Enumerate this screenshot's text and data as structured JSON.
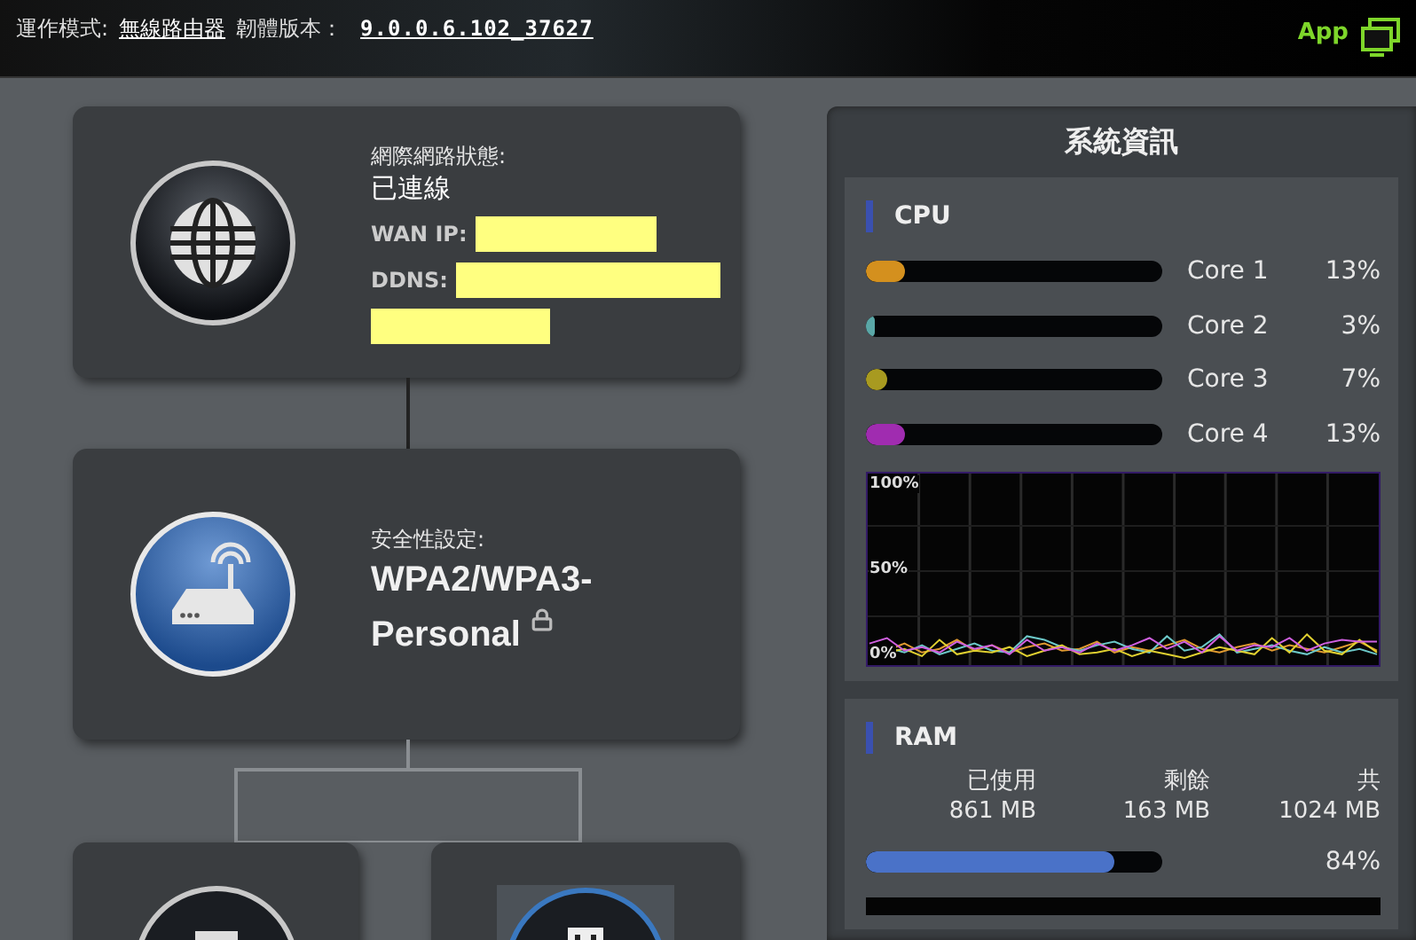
{
  "top_bar": {
    "mode_label": "運作模式:",
    "mode_value": "無線路由器",
    "firmware_label": "韌體版本：",
    "firmware_value": "9.0.0.6.102_37627",
    "app_label": "App"
  },
  "internet_card": {
    "status_label": "網際網路狀態:",
    "status_value": "已連線",
    "wan_ip_label": "WAN IP:",
    "ddns_label": "DDNS:"
  },
  "wireless_card": {
    "security_label": "安全性設定:",
    "security_value": "WPA2/WPA3-Personal",
    "locked": true
  },
  "system_info": {
    "title": "系統資訊",
    "cpu": {
      "title": "CPU",
      "cores": [
        {
          "name": "Core 1",
          "percent": "13%",
          "level": 0.13,
          "color": "#d4901e"
        },
        {
          "name": "Core 2",
          "percent": "3%",
          "level": 0.03,
          "color": "#5aa7a7"
        },
        {
          "name": "Core 3",
          "percent": "7%",
          "level": 0.07,
          "color": "#a89a20"
        },
        {
          "name": "Core 4",
          "percent": "13%",
          "level": 0.13,
          "color": "#a02cb0"
        }
      ],
      "chart_labels": [
        "100%",
        "50%",
        "0%"
      ]
    },
    "ram": {
      "title": "RAM",
      "columns": [
        {
          "label": "已使用",
          "value": "861 MB"
        },
        {
          "label": "剩餘",
          "value": "163 MB"
        },
        {
          "label": "共",
          "value": "1024 MB"
        }
      ],
      "level": 0.84,
      "percent": "84%"
    }
  }
}
